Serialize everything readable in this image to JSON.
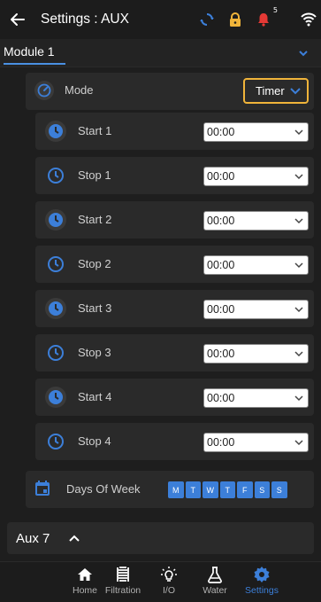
{
  "header": {
    "title": "Settings : AUX",
    "status_icons": [
      "sync-icon",
      "lock-icon",
      "bell-icon"
    ],
    "bell_badge": "5"
  },
  "module": {
    "label": "Module 1"
  },
  "mode": {
    "label": "Mode",
    "value": "Timer"
  },
  "rows": [
    {
      "label": "Start 1",
      "value": "00:00",
      "icon": "clock-filled"
    },
    {
      "label": "Stop 1",
      "value": "00:00",
      "icon": "clock-outline"
    },
    {
      "label": "Start 2",
      "value": "00:00",
      "icon": "clock-filled"
    },
    {
      "label": "Stop 2",
      "value": "00:00",
      "icon": "clock-outline"
    },
    {
      "label": "Start 3",
      "value": "00:00",
      "icon": "clock-filled"
    },
    {
      "label": "Stop 3",
      "value": "00:00",
      "icon": "clock-outline"
    },
    {
      "label": "Start 4",
      "value": "00:00",
      "icon": "clock-filled"
    },
    {
      "label": "Stop 4",
      "value": "00:00",
      "icon": "clock-outline"
    }
  ],
  "days_of_week": {
    "label": "Days Of Week",
    "days": [
      "M",
      "T",
      "W",
      "T",
      "F",
      "S",
      "S"
    ]
  },
  "aux": {
    "label": "Aux 7"
  },
  "nav": {
    "items": [
      {
        "label": "Home"
      },
      {
        "label": "Filtration"
      },
      {
        "label": "I/O"
      },
      {
        "label": "Water"
      },
      {
        "label": "Settings"
      }
    ],
    "active_index": 4
  },
  "colors": {
    "accent_blue": "#3c7fd9",
    "mode_border": "#f0b43a",
    "lock_color": "#f0b43a",
    "bell_color": "#e53935"
  }
}
